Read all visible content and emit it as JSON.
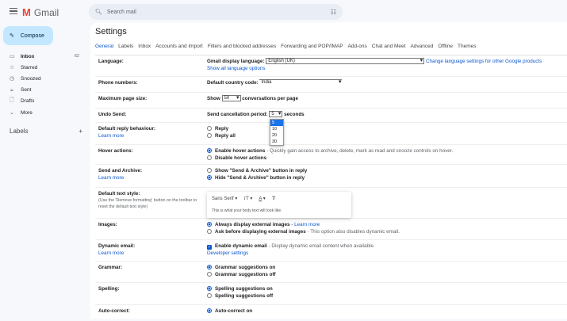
{
  "app": {
    "name": "Gmail"
  },
  "search": {
    "placeholder": "Search mail"
  },
  "compose": "Compose",
  "nav": [
    {
      "label": "Inbox",
      "count": "62",
      "icon": "inbox-icon"
    },
    {
      "label": "Starred",
      "icon": "star-icon"
    },
    {
      "label": "Snoozed",
      "icon": "clock-icon"
    },
    {
      "label": "Sent",
      "icon": "send-icon"
    },
    {
      "label": "Drafts",
      "icon": "draft-icon"
    },
    {
      "label": "More",
      "icon": "chevron-down-icon"
    }
  ],
  "labels": {
    "title": "Labels",
    "add": "+"
  },
  "settings": {
    "title": "Settings",
    "tabs": [
      "General",
      "Labels",
      "Inbox",
      "Accounts and Import",
      "Filters and blocked addresses",
      "Forwarding and POP/IMAP",
      "Add-ons",
      "Chat and Meet",
      "Advanced",
      "Offline",
      "Themes"
    ],
    "language": {
      "label": "Language:",
      "prefix": "Gmail display language:",
      "value": "English (UK)",
      "link": "Change language settings for other Google products",
      "show_all": "Show all language options"
    },
    "phone": {
      "label": "Phone numbers:",
      "prefix": "Default country code:",
      "value": "India"
    },
    "page_size": {
      "label": "Maximum page size:",
      "show": "Show",
      "value": "50",
      "suffix": "conversations per page"
    },
    "undo": {
      "label": "Undo Send:",
      "prefix": "Send cancellation period:",
      "value": "5",
      "suffix": "seconds",
      "options": [
        "5",
        "10",
        "20",
        "30"
      ]
    },
    "reply": {
      "label": "Default reply behaviour:",
      "learn": "Learn more",
      "opt1": "Reply",
      "opt2": "Reply all"
    },
    "hover": {
      "label": "Hover actions:",
      "opt1": "Enable hover actions",
      "opt1_desc": " - Quickly gain access to archive, delete, mark as read and snooze controls on hover.",
      "opt2": "Disable hover actions"
    },
    "send_archive": {
      "label": "Send and Archive:",
      "learn": "Learn more",
      "opt1": "Show \"Send & Archive\" button in reply",
      "opt2": "Hide \"Send & Archive\" button in reply"
    },
    "text_style": {
      "label": "Default text style:",
      "sub": "(Use the 'Remove formatting' button on the toolbar to reset the default text style)",
      "font": "Sans Serif",
      "size": "тT",
      "color": "A",
      "clear": "T̸",
      "preview": "This is what your body text will look like."
    },
    "images": {
      "label": "Images:",
      "opt1": "Always display external images",
      "opt1_link": "Learn more",
      "opt2": "Ask before displaying external images",
      "opt2_desc": " - This option also disables dynamic email."
    },
    "dynamic": {
      "label": "Dynamic email:",
      "learn": "Learn more",
      "opt": "Enable dynamic email",
      "desc": " - Display dynamic email content when available.",
      "dev": "Developer settings"
    },
    "grammar": {
      "label": "Grammar:",
      "opt1": "Grammar suggestions on",
      "opt2": "Grammar suggestions off"
    },
    "spelling": {
      "label": "Spelling:",
      "opt1": "Spelling suggestions on",
      "opt2": "Spelling suggestions off"
    },
    "autocorrect": {
      "label": "Auto-correct:",
      "opt1": "Auto-correct on"
    }
  }
}
